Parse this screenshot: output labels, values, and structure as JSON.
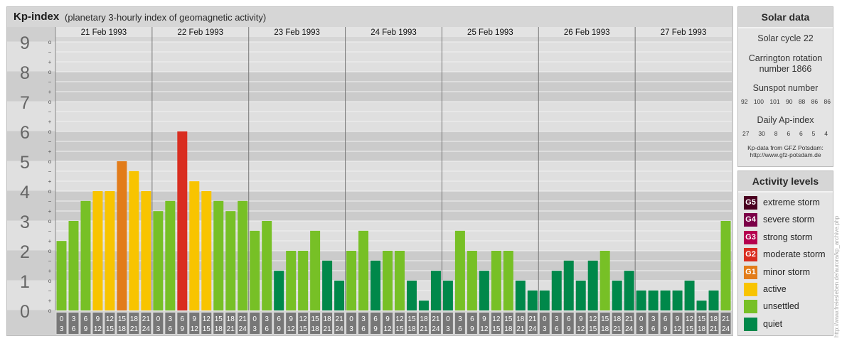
{
  "header": {
    "title": "Kp-index",
    "subtitle": "(planetary 3-hourly index of geomagnetic activity)"
  },
  "colors": {
    "quiet": "#00884a",
    "unsettled": "#77c026",
    "active": "#f8c400",
    "g1": "#e27c1a",
    "g2": "#d92d20",
    "g3": "#b5004f",
    "g4": "#7b0047",
    "g5": "#4a0020"
  },
  "chart_data": {
    "type": "bar",
    "title": "Kp-index",
    "subtitle": "(planetary 3-hourly index of geomagnetic activity)",
    "ylim": [
      0,
      9
    ],
    "y_ticks": [
      "0",
      "1",
      "2",
      "3",
      "4",
      "5",
      "6",
      "7",
      "8",
      "9"
    ],
    "y_minor_ticks": [
      "o",
      "+",
      "−"
    ],
    "days": [
      "21 Feb 1993",
      "22 Feb 1993",
      "23 Feb 1993",
      "24 Feb 1993",
      "25 Feb 1993",
      "26 Feb 1993",
      "27 Feb 1993"
    ],
    "interval_labels": [
      [
        "0",
        "3"
      ],
      [
        "3",
        "6"
      ],
      [
        "6",
        "9"
      ],
      [
        "9",
        "12"
      ],
      [
        "12",
        "15"
      ],
      [
        "15",
        "18"
      ],
      [
        "18",
        "21"
      ],
      [
        "21",
        "24"
      ]
    ],
    "values": [
      [
        2.33,
        3.0,
        3.67,
        4.0,
        4.0,
        5.0,
        4.67,
        4.0
      ],
      [
        3.33,
        3.67,
        6.0,
        4.33,
        4.0,
        3.67,
        3.33,
        3.67
      ],
      [
        2.67,
        3.0,
        1.33,
        2.0,
        2.0,
        2.67,
        1.67,
        1.0
      ],
      [
        2.0,
        2.67,
        1.67,
        2.0,
        2.0,
        1.0,
        0.33,
        1.33
      ],
      [
        1.0,
        2.67,
        2.0,
        1.33,
        2.0,
        2.0,
        1.0,
        0.67
      ],
      [
        0.67,
        1.33,
        1.67,
        1.0,
        1.67,
        2.0,
        1.0,
        1.33
      ],
      [
        0.67,
        0.67,
        0.67,
        0.67,
        1.0,
        0.33,
        0.67,
        3.0
      ]
    ],
    "grid": true
  },
  "solar": {
    "title": "Solar data",
    "cycle": "Solar cycle 22",
    "carrington_1": "Carrington rotation",
    "carrington_2": "number 1866",
    "sunspot_title": "Sunspot number",
    "sunspot_values": [
      "92",
      "100",
      "101",
      "90",
      "88",
      "86",
      "86"
    ],
    "ap_title": "Daily Ap-index",
    "ap_values": [
      "27",
      "30",
      "8",
      "6",
      "6",
      "5",
      "4"
    ],
    "source_1": "Kp-data from GFZ Potsdam:",
    "source_2": "http://www.gfz-potsdam.de"
  },
  "activity": {
    "title": "Activity levels",
    "items": [
      {
        "badge": "G5",
        "label": "extreme storm",
        "color": "#4a0020"
      },
      {
        "badge": "G4",
        "label": "severe storm",
        "color": "#7b0047"
      },
      {
        "badge": "G3",
        "label": "strong storm",
        "color": "#b5004f"
      },
      {
        "badge": "G2",
        "label": "moderate storm",
        "color": "#d92d20"
      },
      {
        "badge": "G1",
        "label": "minor storm",
        "color": "#e27c1a"
      },
      {
        "badge": "",
        "label": "active",
        "color": "#f8c400"
      },
      {
        "badge": "",
        "label": "unsettled",
        "color": "#77c026"
      },
      {
        "badge": "",
        "label": "quiet",
        "color": "#00884a"
      }
    ]
  },
  "watermark": "http://www.freiesleben.de/aurora/kp_archive.php"
}
